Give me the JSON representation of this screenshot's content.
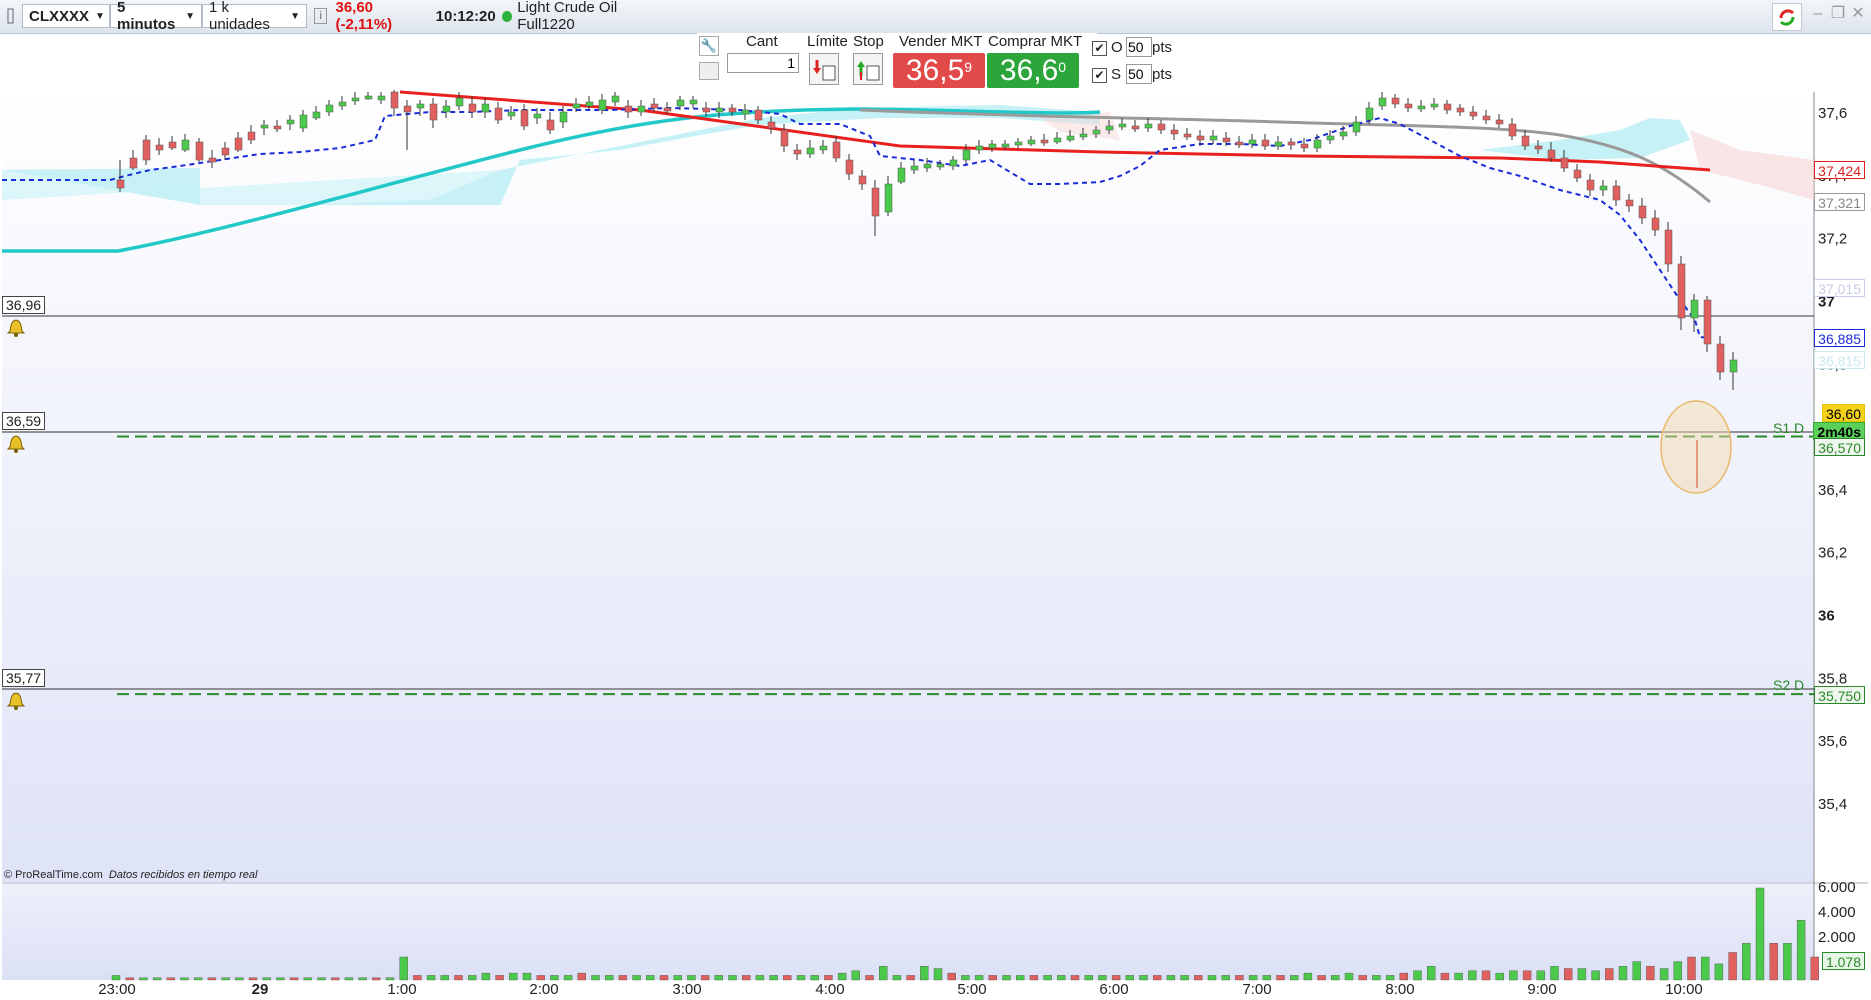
{
  "toolbar": {
    "instrument": "CLXXXX",
    "timeframe": "5 minutos",
    "units": "1 k unidades",
    "price_change": "36,60 (-2,11%)",
    "time": "10:12:20",
    "instrument_name": "Light Crude Oil Full1220"
  },
  "order": {
    "qty_label": "Cant",
    "qty_value": "1",
    "limit_label": "Límite",
    "stop_label": "Stop",
    "sell_label": "Vender MKT",
    "sell_main": "36,5",
    "sell_sup": "9",
    "buy_label": "Comprar MKT",
    "buy_main": "36,6",
    "buy_sup": "0",
    "o_label": "O",
    "o_value": "50",
    "s_label": "S",
    "s_value": "50",
    "pts": "pts"
  },
  "levels": {
    "a": "36,96",
    "b": "36,59",
    "c": "35,77",
    "s1": "S1 D",
    "s2": "S2 D"
  },
  "price_tags": {
    "ma_red": "37,424",
    "ma_gray": "37,321",
    "faded1": "37,015",
    "dotted": "36,885",
    "faded2": "36,815",
    "last": "36,60",
    "timer": "2m40s",
    "s1": "36,570",
    "s2": "35,750",
    "vol": "1.078"
  },
  "footer": {
    "brand": "© ProRealTime.com",
    "note": "Datos recibidos en tiempo real"
  },
  "colors": {
    "bull": "#4bc94b",
    "bear": "#e06060",
    "ma_red": "#e8201e",
    "ma_gray": "#9a9a9a",
    "ma_cyan": "#22c8c8",
    "dotted": "#1a2bd8",
    "level_green": "#2a8a2a"
  },
  "chart_data": {
    "type": "candlestick",
    "y_ticks": [
      "37,6",
      "37,4",
      "37,2",
      "37",
      "36,8",
      "36,6",
      "36,4",
      "36,2",
      "36",
      "35,8",
      "35,6",
      "35,4"
    ],
    "vol_ticks": [
      "6.000",
      "4.000",
      "2.000"
    ],
    "x_labels": [
      "23:00",
      "29",
      "1:00",
      "2:00",
      "3:00",
      "4:00",
      "5:00",
      "6:00",
      "7:00",
      "8:00",
      "9:00",
      "10:00"
    ],
    "last_price": 36.6,
    "s1": 36.57,
    "s2": 35.75
  }
}
